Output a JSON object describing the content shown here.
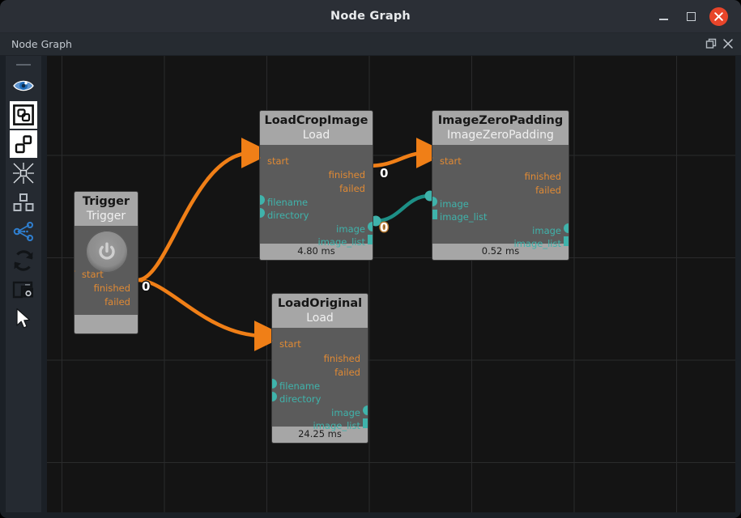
{
  "window": {
    "title": "Node Graph",
    "minimize_label": "–",
    "maximize_label": "□",
    "close_label": "✕"
  },
  "tabbar": {
    "label": "Node Graph",
    "undock_icon": "undock-icon",
    "close_icon": "close-icon"
  },
  "sidebar": {
    "items": [
      {
        "name": "drag-handle",
        "icon": "handle-icon",
        "active": false
      },
      {
        "name": "visibility-toggle",
        "icon": "eye-icon",
        "active": false
      },
      {
        "name": "frame-nodes",
        "icon": "frame-node-icon",
        "active": true
      },
      {
        "name": "group-nodes",
        "icon": "two-squares-icon",
        "active": true
      },
      {
        "name": "fit-to-view",
        "icon": "collapse-arrows-icon",
        "active": false
      },
      {
        "name": "node-hierarchy",
        "icon": "hierarchy-icon",
        "active": false
      },
      {
        "name": "graph-connections",
        "icon": "share-nodes-icon",
        "active": false
      },
      {
        "name": "refresh-graph",
        "icon": "refresh-icon",
        "active": false
      },
      {
        "name": "screenshot",
        "icon": "camera-icon",
        "active": false
      },
      {
        "name": "select-tool",
        "icon": "cursor-icon",
        "active": false
      }
    ]
  },
  "colors": {
    "exec_port": "#e08a34",
    "exec_wire": "#f07f17",
    "data_port": "#3fb3ab",
    "data_wire": "#1d8f86",
    "node_header": "#a6a6a6",
    "node_body": "#5b5b5b",
    "canvas": "#141414",
    "close_button": "#e8452a"
  },
  "graph": {
    "nodes": [
      {
        "id": "trigger",
        "title": "Trigger",
        "subtitle": "Trigger",
        "footer": "",
        "widget": "power-button",
        "inputs_exec": [
          "start"
        ],
        "outputs_exec": [
          "finished",
          "failed"
        ],
        "inputs_data": [],
        "outputs_data": []
      },
      {
        "id": "loadcropimage",
        "title": "LoadCropImage",
        "subtitle": "Load",
        "footer": "4.80 ms",
        "inputs_exec": [
          "start"
        ],
        "outputs_exec": [
          "finished",
          "failed"
        ],
        "inputs_data": [
          "filename",
          "directory"
        ],
        "outputs_data": [
          "image",
          "image_list"
        ]
      },
      {
        "id": "imagezeropadding",
        "title": "ImageZeroPadding",
        "subtitle": "ImageZeroPadding",
        "footer": "0.52 ms",
        "inputs_exec": [
          "start"
        ],
        "outputs_exec": [
          "finished",
          "failed"
        ],
        "inputs_data": [
          "image",
          "image_list"
        ],
        "outputs_data": [
          "image",
          "image_list"
        ]
      },
      {
        "id": "loadoriginal",
        "title": "LoadOriginal",
        "subtitle": "Load",
        "footer": "24.25 ms",
        "inputs_exec": [
          "start"
        ],
        "outputs_exec": [
          "finished",
          "failed"
        ],
        "inputs_data": [
          "filename",
          "directory"
        ],
        "outputs_data": [
          "image",
          "image_list"
        ]
      }
    ],
    "badges": [
      {
        "id": "b1",
        "value": "0",
        "style": "dark"
      },
      {
        "id": "b2",
        "value": "0",
        "style": "dark"
      },
      {
        "id": "b3",
        "value": "0",
        "style": "warm"
      }
    ],
    "connections": [
      {
        "from": "trigger.finished",
        "to": "loadcropimage.start",
        "kind": "exec"
      },
      {
        "from": "trigger.finished",
        "to": "loadoriginal.start",
        "kind": "exec"
      },
      {
        "from": "loadcropimage.finished",
        "to": "imagezeropadding.start",
        "kind": "exec"
      },
      {
        "from": "loadcropimage.image",
        "to": "imagezeropadding.image",
        "kind": "data"
      }
    ]
  }
}
